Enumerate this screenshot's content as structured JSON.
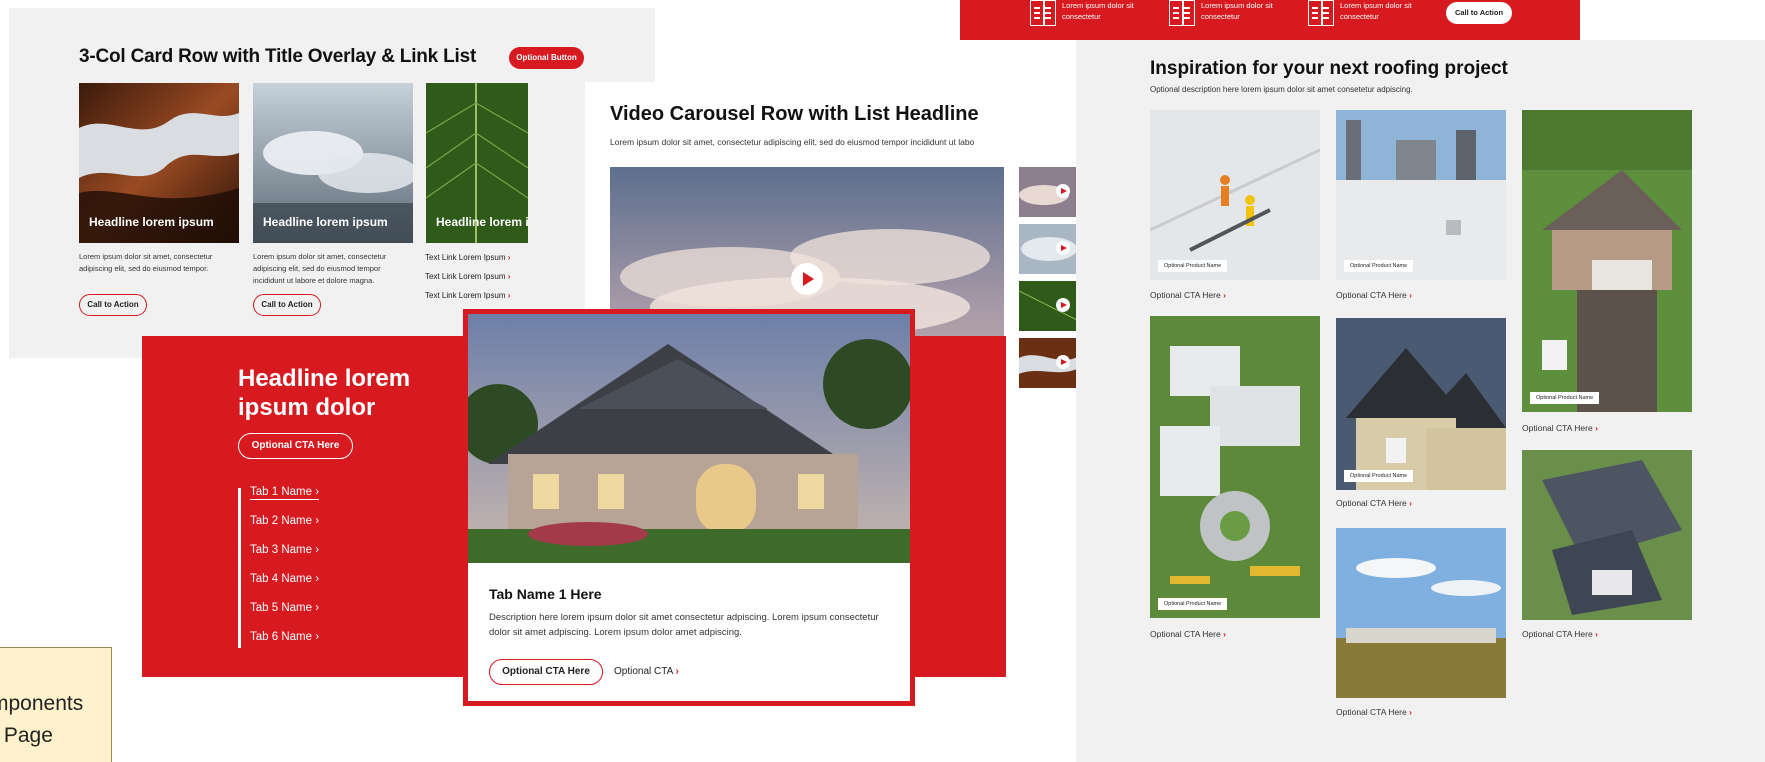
{
  "note": {
    "line1": "mponents",
    "line2": "r Page"
  },
  "card_row": {
    "title": "3-Col Card Row with Title Overlay & Link List",
    "optional_button": "Optional Button",
    "cards": [
      {
        "headline": "Headline lorem ipsum",
        "description": "Lorem ipsum dolor sit amet, consectetur adipiscing elit, sed do eiusmod tempor.",
        "cta": "Call to Action"
      },
      {
        "headline": "Headline lorem ipsum",
        "description": "Lorem ipsum dolor sit amet, consectetur adipiscing elit, sed do eiusmod tempor incididunt ut labore et dolore magna.",
        "cta": "Call to Action"
      },
      {
        "headline": "Headline lorem ipsum"
      }
    ],
    "links": [
      "Text Link Lorem Ipsum",
      "Text Link Lorem Ipsum",
      "Text Link Lorem Ipsum"
    ]
  },
  "video": {
    "title": "Video Carousel Row with List Headline",
    "subtitle": "Lorem ipsum dolor sit amet, consectetur adipiscing elit, sed do eiusmod tempor incididunt ut labo"
  },
  "strip": {
    "items": [
      "Lorem ipsum dolor sit consectetur",
      "Lorem ipsum dolor sit consectetur",
      "Lorem ipsum dolor sit consectetur"
    ],
    "cta": "Call to Action"
  },
  "tabs_module": {
    "headline": "Headline lorem ipsum dolor",
    "cta": "Optional CTA Here",
    "tabs": [
      "Tab 1 Name",
      "Tab 2 Name",
      "Tab 3 Name",
      "Tab 4 Name",
      "Tab 5 Name",
      "Tab 6 Name"
    ],
    "panel": {
      "title": "Tab Name 1 Here",
      "description": "Description here lorem ipsum dolor sit amet consectetur adpiscing. Lorem ipsum consectetur dolor sit amet adpiscing. Lorem ipsum dolor amet adpiscing.",
      "primary_cta": "Optional CTA Here",
      "secondary_cta": "Optional CTA"
    }
  },
  "inspiration": {
    "title": "Inspiration for your next roofing project",
    "subtitle": "Optional description here lorem ipsum dolor sit amet consetetur adpiscing.",
    "product_tag": "Optional Product Name",
    "tile_cta": "Optional CTA Here"
  },
  "colors": {
    "brand_red": "#d71920",
    "panel_gray": "#f1f1f1"
  }
}
